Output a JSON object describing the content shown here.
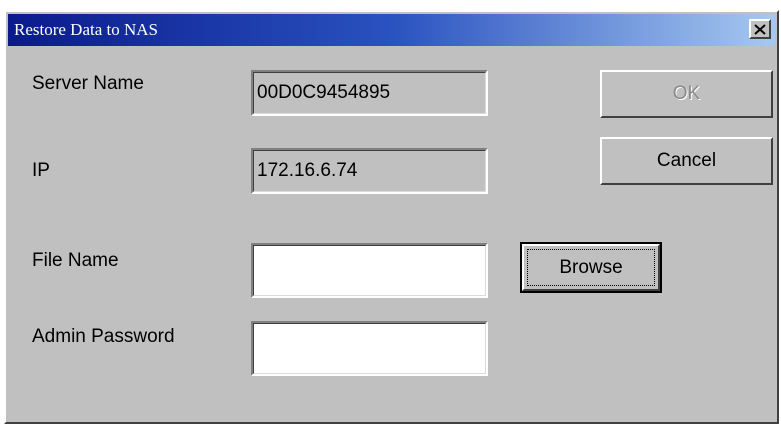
{
  "window": {
    "title": "Restore Data to NAS"
  },
  "form": {
    "server_name_label": "Server Name",
    "server_name_value": "00D0C9454895",
    "ip_label": "IP",
    "ip_value": "172.16.6.74",
    "file_name_label": "File Name",
    "file_name_value": "",
    "admin_password_label": "Admin Password",
    "admin_password_value": ""
  },
  "buttons": {
    "ok_label": "OK",
    "cancel_label": "Cancel",
    "browse_label": "Browse"
  },
  "icons": {
    "close": "close-icon"
  },
  "colors": {
    "title_start": "#0a1a8c",
    "title_end": "#a6c8f0",
    "dialog_bg": "#c0c0c0"
  }
}
